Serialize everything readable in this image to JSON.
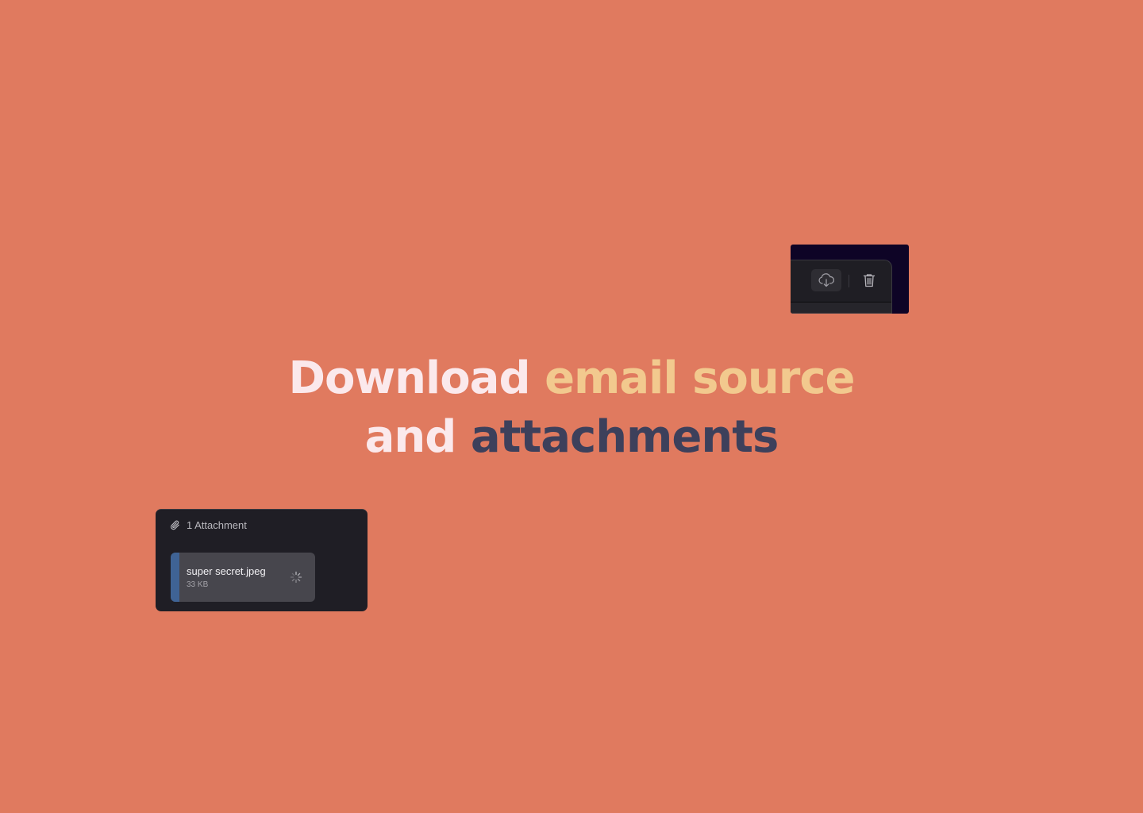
{
  "colors": {
    "background": "#E07A5F",
    "headline_white": "#FBE9EC",
    "headline_gold": "#F2C98E",
    "headline_navy": "#3D405B",
    "panel_dark": "#1F1E25",
    "file_accent": "#3F6395"
  },
  "headline": {
    "line1_part1": "Download",
    "line1_part2": "email source",
    "line2_part1": "and",
    "line2_part2": "attachments"
  },
  "toolbar": {
    "download_icon": "cloud-download-icon",
    "delete_icon": "trash-icon"
  },
  "attachments": {
    "header_icon": "paperclip-icon",
    "header_label": "1 Attachment",
    "files": [
      {
        "name": "super secret.jpeg",
        "size": "33 KB",
        "status_icon": "loading-spinner-icon"
      }
    ]
  }
}
